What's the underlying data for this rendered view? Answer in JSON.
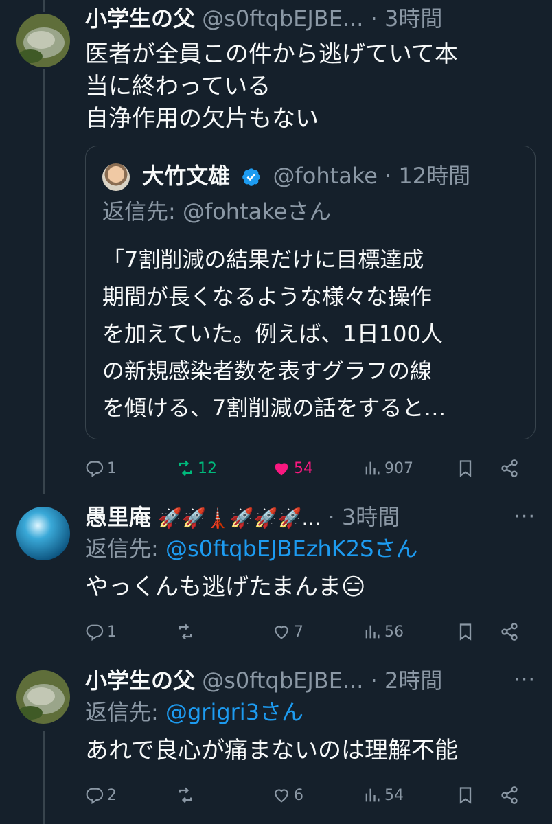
{
  "tweets": [
    {
      "name": "小学生の父",
      "handle": "@s0ftqbEJBE...",
      "dot": "·",
      "time": "3時間",
      "body": "医者が全員この件から逃げていて本\n当に終わっている\n自浄作用の欠片もない",
      "quote": {
        "name": "大竹文雄",
        "handle": "@fohtake",
        "dot": "·",
        "time": "12時間",
        "reply_to": "返信先: @fohtakeさん",
        "body": "「7割削減の結果だけに目標達成\n期間が長くなるような様々な操作\nを加えていた。例えば、1日100人\nの新規感染者数を表すグラフの線\nを傾ける、7割削減の話をすると…"
      },
      "actions": {
        "replies": "1",
        "retweets": "12",
        "likes": "54",
        "views": "907"
      }
    },
    {
      "name": "愚里庵",
      "name_emoji": "🚀🚀🗼🚀🚀🚀…",
      "dot": "·",
      "time": "3時間",
      "more": "···",
      "reply_prefix": "返信先: ",
      "reply_mention": "@s0ftqbEJBEzhK2Sさん",
      "body": "やっくんも逃げたまんま😑",
      "actions": {
        "replies": "1",
        "retweets": "",
        "likes": "7",
        "views": "56"
      }
    },
    {
      "name": "小学生の父",
      "handle": "@s0ftqbEJBE...",
      "dot": "·",
      "time": "2時間",
      "more": "···",
      "reply_prefix": "返信先: ",
      "reply_mention": "@grigri3さん",
      "body": "あれで良心が痛まないのは理解不能",
      "actions": {
        "replies": "2",
        "retweets": "",
        "likes": "6",
        "views": "54"
      }
    }
  ],
  "colors": {
    "background": "#15202b",
    "muted": "#8b98a5",
    "link": "#1d9bf0",
    "retweet": "#00ba7c",
    "like": "#f91880"
  }
}
